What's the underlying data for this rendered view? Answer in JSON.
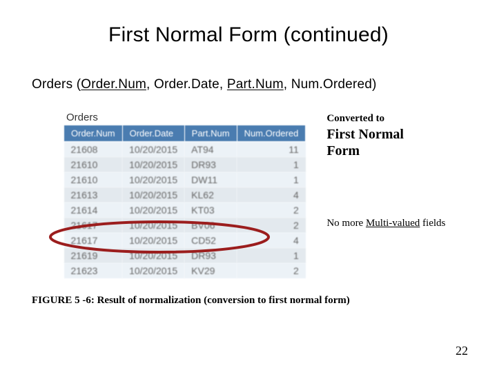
{
  "title": "First Normal Form (continued)",
  "relation": {
    "table": "Orders",
    "open": "(",
    "close": ")",
    "sep": ", ",
    "attrs": [
      {
        "name": "Order.Num",
        "pk": true
      },
      {
        "name": "Order.Date",
        "pk": false
      },
      {
        "name": "Part.Num",
        "pk": true
      },
      {
        "name": "Num.Ordered",
        "pk": false
      }
    ]
  },
  "table": {
    "caption": "Orders",
    "headers": [
      "Order.Num",
      "Order.Date",
      "Part.Num",
      "Num.Ordered"
    ],
    "rows": [
      [
        "21608",
        "10/20/2015",
        "AT94",
        "11"
      ],
      [
        "21610",
        "10/20/2015",
        "DR93",
        "1"
      ],
      [
        "21610",
        "10/20/2015",
        "DW11",
        "1"
      ],
      [
        "21613",
        "10/20/2015",
        "KL62",
        "4"
      ],
      [
        "21614",
        "10/20/2015",
        "KT03",
        "2"
      ],
      [
        "21617",
        "10/20/2015",
        "BV06",
        "2"
      ],
      [
        "21617",
        "10/20/2015",
        "CD52",
        "4"
      ],
      [
        "21619",
        "10/20/2015",
        "DR93",
        "1"
      ],
      [
        "21623",
        "10/20/2015",
        "KV29",
        "2"
      ]
    ]
  },
  "side": {
    "converted_label": "Converted to",
    "big1": "First Normal",
    "big2": "Form",
    "note_prefix": "No more ",
    "note_link": "Multi-valued",
    "note_suffix": " fields"
  },
  "figure_caption": "FIGURE 5 -6: Result of normalization (conversion to first normal form)",
  "pagenum": "22",
  "chart_data": {
    "type": "table",
    "title": "Orders",
    "columns": [
      "Order.Num",
      "Order.Date",
      "Part.Num",
      "Num.Ordered"
    ],
    "rows": [
      [
        "21608",
        "10/20/2015",
        "AT94",
        11
      ],
      [
        "21610",
        "10/20/2015",
        "DR93",
        1
      ],
      [
        "21610",
        "10/20/2015",
        "DW11",
        1
      ],
      [
        "21613",
        "10/20/2015",
        "KL62",
        4
      ],
      [
        "21614",
        "10/20/2015",
        "KT03",
        2
      ],
      [
        "21617",
        "10/20/2015",
        "BV06",
        2
      ],
      [
        "21617",
        "10/20/2015",
        "CD52",
        4
      ],
      [
        "21619",
        "10/20/2015",
        "DR93",
        1
      ],
      [
        "21623",
        "10/20/2015",
        "KV29",
        2
      ]
    ]
  }
}
